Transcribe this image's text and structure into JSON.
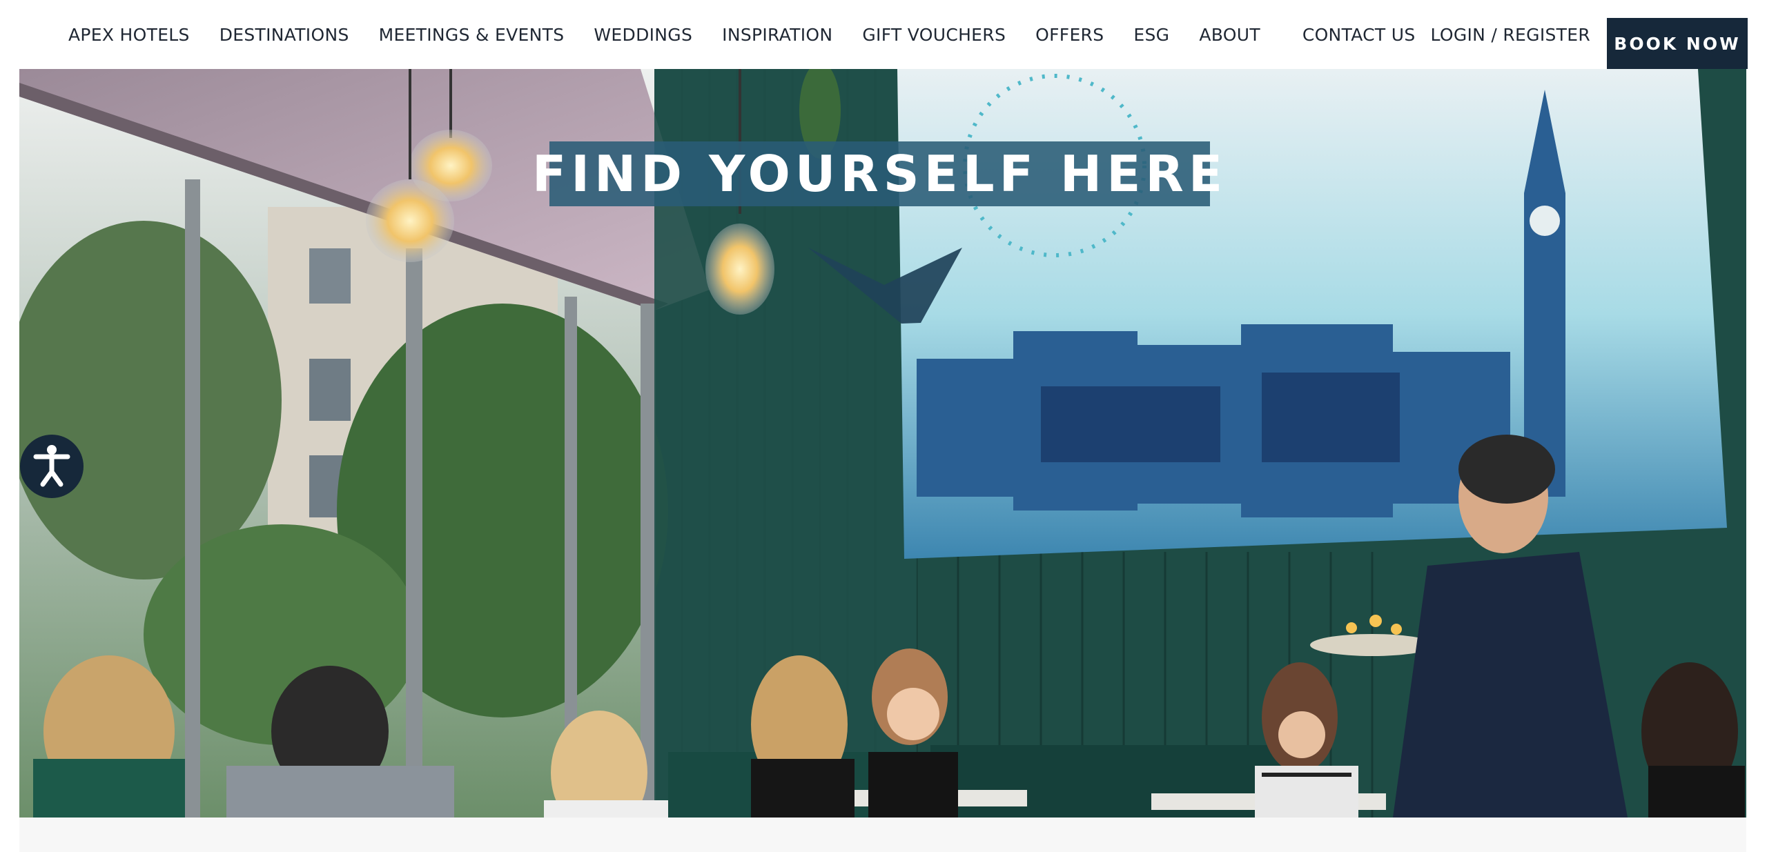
{
  "header": {
    "nav_items": [
      "APEX HOTELS",
      "DESTINATIONS",
      "MEETINGS & EVENTS",
      "WEDDINGS",
      "INSPIRATION",
      "GIFT VOUCHERS",
      "OFFERS",
      "ESG",
      "ABOUT"
    ],
    "contact_label": "CONTACT US",
    "login_label": "LOGIN / REGISTER",
    "book_label": "BOOK NOW"
  },
  "hero": {
    "title": "FIND YOURSELF HERE",
    "scroll_icon": "chevron-down-icon",
    "image_description_icon": "restaurant-photo"
  },
  "accessibility": {
    "icon": "accessibility-icon"
  },
  "colors": {
    "brand_navy": "#16283a",
    "title_box": "#2a5c76",
    "chevron": "#1f4259",
    "hero_green": "#1d4a44"
  }
}
